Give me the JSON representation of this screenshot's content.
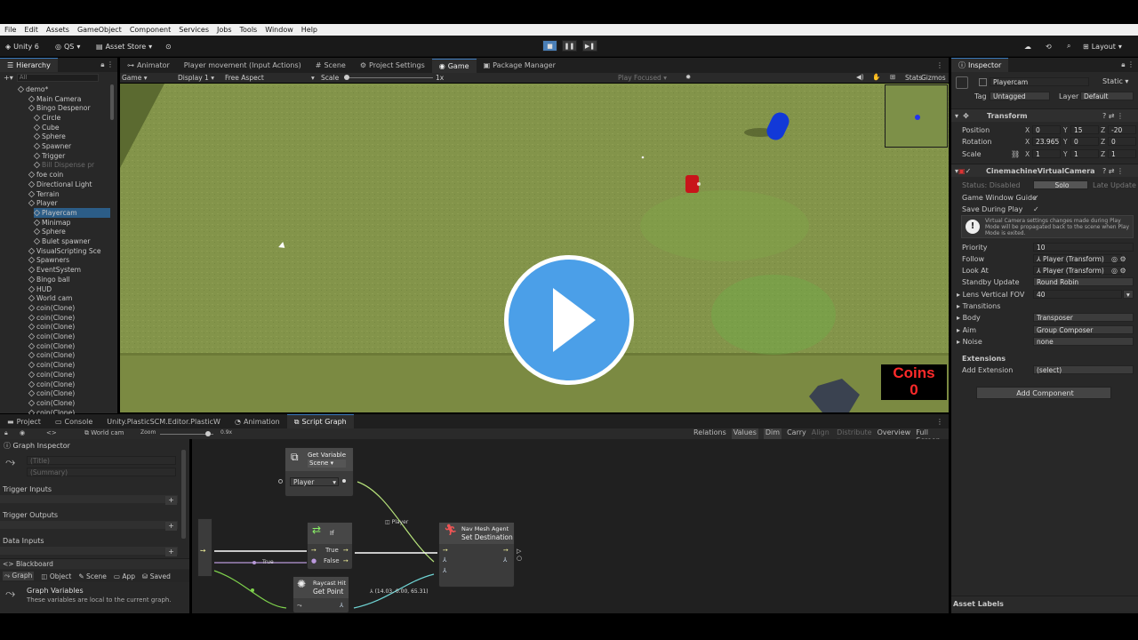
{
  "menu": [
    "File",
    "Edit",
    "Assets",
    "GameObject",
    "Component",
    "Services",
    "Jobs",
    "Tools",
    "Window",
    "Help"
  ],
  "toolbar": {
    "account": "Unity 6",
    "qs": "QS",
    "asset_store": "Asset Store",
    "layout": "Layout"
  },
  "hierarchy": {
    "title": "Hierarchy",
    "search_placeholder": "All",
    "items": [
      {
        "label": "demo*",
        "indent": 0,
        "icon": "scene"
      },
      {
        "label": "Main Camera",
        "indent": 2
      },
      {
        "label": "Bingo Despenor",
        "indent": 2
      },
      {
        "label": "Circle",
        "indent": 3
      },
      {
        "label": "Cube",
        "indent": 3
      },
      {
        "label": "Sphere",
        "indent": 3
      },
      {
        "label": "Spawner",
        "indent": 3
      },
      {
        "label": "Trigger",
        "indent": 3
      },
      {
        "label": "Bill Dispense pr",
        "indent": 3,
        "dim": true
      },
      {
        "label": "foe coin",
        "indent": 2
      },
      {
        "label": "Directional Light",
        "indent": 2
      },
      {
        "label": "Terrain",
        "indent": 2
      },
      {
        "label": "Player",
        "indent": 2
      },
      {
        "label": "Playercam",
        "indent": 3,
        "selected": true
      },
      {
        "label": "Minimap",
        "indent": 3
      },
      {
        "label": "Sphere",
        "indent": 3
      },
      {
        "label": "Bulet spawner",
        "indent": 3
      },
      {
        "label": "VisualScripting Sce",
        "indent": 2
      },
      {
        "label": "Spawners",
        "indent": 2
      },
      {
        "label": "EventSystem",
        "indent": 2
      },
      {
        "label": "Bingo ball",
        "indent": 2
      },
      {
        "label": "HUD",
        "indent": 2
      },
      {
        "label": "World cam",
        "indent": 2
      },
      {
        "label": "coin(Clone)",
        "indent": 2
      },
      {
        "label": "coin(Clone)",
        "indent": 2
      },
      {
        "label": "coin(Clone)",
        "indent": 2
      },
      {
        "label": "coin(Clone)",
        "indent": 2
      },
      {
        "label": "coin(Clone)",
        "indent": 2
      },
      {
        "label": "coin(Clone)",
        "indent": 2
      },
      {
        "label": "coin(Clone)",
        "indent": 2
      },
      {
        "label": "coin(Clone)",
        "indent": 2
      },
      {
        "label": "coin(Clone)",
        "indent": 2
      },
      {
        "label": "coin(Clone)",
        "indent": 2
      },
      {
        "label": "coin(Clone)",
        "indent": 2
      },
      {
        "label": "coin(Clone)",
        "indent": 2
      }
    ]
  },
  "center_tabs": [
    "Animator",
    "Player movement (Input Actions)",
    "Scene",
    "Project Settings",
    "Game",
    "Package Manager"
  ],
  "game_toolbar": {
    "mode": "Game",
    "display": "Display 1",
    "aspect": "Free Aspect",
    "scale_label": "Scale",
    "scale_value": "1x",
    "play_focused": "Play Focused",
    "stats": "Stats",
    "gizmos": "Gizmos"
  },
  "game_view": {
    "coins_label": "Coins",
    "coins_value": "0"
  },
  "bottom_tabs": [
    "Project",
    "Console",
    "Unity.PlasticSCM.Editor.PlasticW",
    "Animation",
    "Script Graph"
  ],
  "graph_toolbar": {
    "world_cam": "World cam",
    "zoom_label": "Zoom",
    "zoom_value": "0.9x",
    "buttons": [
      "Relations",
      "Values",
      "Dim",
      "Carry",
      "Align",
      "Distribute",
      "Overview",
      "Full Screen"
    ]
  },
  "graph_inspector": {
    "title": "Graph Inspector",
    "title_placeholder": "(Title)",
    "summary_placeholder": "(Summary)",
    "sections": [
      "Trigger Inputs",
      "Trigger Outputs",
      "Data Inputs"
    ],
    "blackboard": "Blackboard",
    "bb_tabs": [
      "Graph",
      "Object",
      "Scene",
      "App",
      "Saved"
    ],
    "vars_title": "Graph Variables",
    "vars_desc": "These variables are local to the current graph."
  },
  "nodes": {
    "get_variable": {
      "title": "Get Variable",
      "kind": "Scene",
      "value": "Player"
    },
    "if": {
      "title": "If",
      "true_label": "True",
      "false_label": "False"
    },
    "set_destination": {
      "title_top": "Nav Mesh Agent",
      "title": "Set Destination"
    },
    "raycast": {
      "title_top": "Raycast Hit",
      "title": "Get Point"
    },
    "edge_label_player": "Player",
    "edge_label_true": "True",
    "point_value": "(14.03, 0.00, 65.31)"
  },
  "inspector": {
    "title": "Inspector",
    "object_name": "Playercam",
    "static": "Static",
    "tag_label": "Tag",
    "tag": "Untagged",
    "layer_label": "Layer",
    "layer": "Default",
    "transform": {
      "title": "Transform",
      "position_label": "Position",
      "rotation_label": "Rotation",
      "scale_label": "Scale",
      "position": [
        "0",
        "15",
        "-20"
      ],
      "rotation": [
        "23.965",
        "0",
        "0"
      ],
      "scale": [
        "1",
        "1",
        "1"
      ]
    },
    "cinemachine": {
      "title": "CinemachineVirtualCamera",
      "status_label": "Status: Disabled",
      "solo": "Solo",
      "late_update": "Late Update",
      "gwg_label": "Game Window Guide",
      "sdp_label": "Save During Play",
      "warning": "Virtual Camera settings changes made during Play Mode will be propagated back to the scene when Play Mode is exited.",
      "priority_label": "Priority",
      "priority": "10",
      "follow_label": "Follow",
      "follow": "Player (Transform)",
      "lookat_label": "Look At",
      "lookat": "Player (Transform)",
      "standby_label": "Standby Update",
      "standby": "Round Robin",
      "fov_label": "Lens Vertical FOV",
      "fov": "40",
      "transitions": "Transitions",
      "body_label": "Body",
      "body": "Transposer",
      "aim_label": "Aim",
      "aim": "Group Composer",
      "noise_label": "Noise",
      "noise": "none",
      "extensions": "Extensions",
      "add_ext_label": "Add Extension",
      "add_ext": "(select)"
    },
    "add_component": "Add Component",
    "asset_labels": "Asset Labels"
  },
  "colors": {
    "accent": "#3a79bb",
    "coins_bg": "#000000",
    "coins_text": "#ff2a2a",
    "play_overlay": "#4b9fe8"
  }
}
